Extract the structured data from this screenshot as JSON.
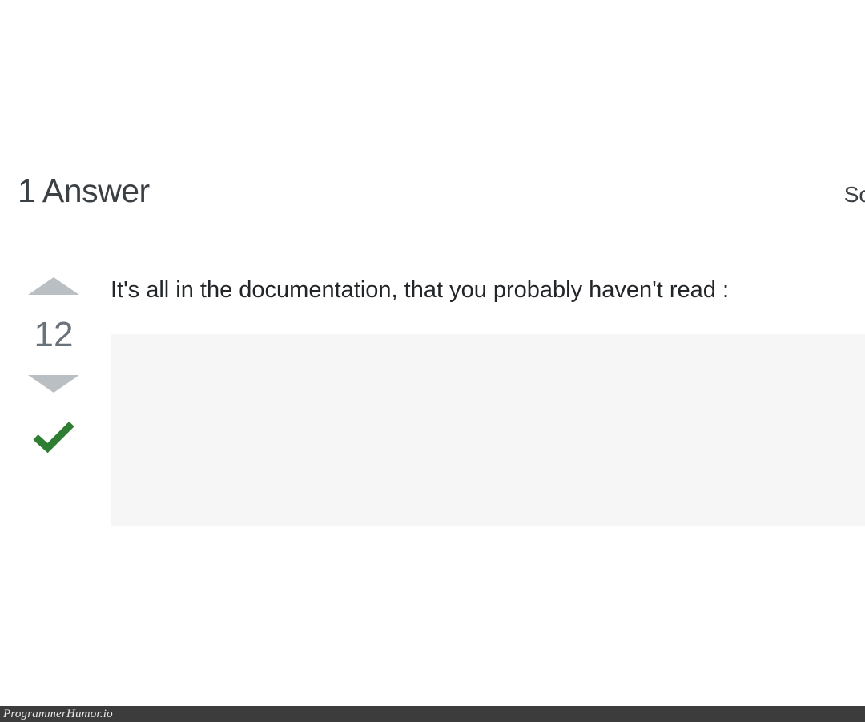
{
  "header": {
    "title": "1 Answer",
    "sort_label": "So"
  },
  "answer": {
    "vote_count": "12",
    "body_text": "It's all in the documentation, that you probably haven't read :"
  },
  "watermark": "ProgrammerHumor.io"
}
